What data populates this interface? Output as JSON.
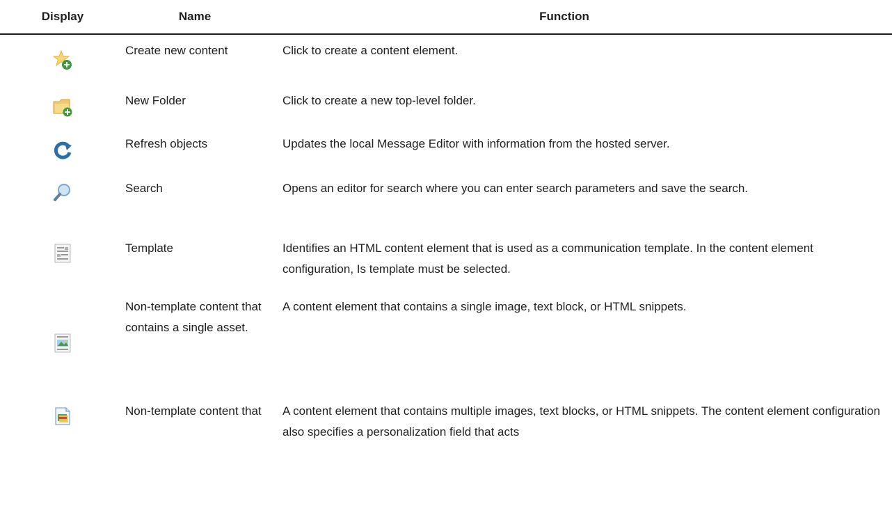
{
  "header": {
    "display": "Display",
    "name": "Name",
    "function": "Function"
  },
  "rows": [
    {
      "icon": "star-add-icon",
      "name": "Create new content",
      "function": "Click to create a content element."
    },
    {
      "icon": "folder-add-icon",
      "name": "New Folder",
      "function": "Click to create a new top-level folder."
    },
    {
      "icon": "refresh-icon",
      "name": "Refresh objects",
      "function": "Updates the local Message Editor with information from the hosted server."
    },
    {
      "icon": "search-icon",
      "name": "Search",
      "function": "Opens an editor for search where you can enter search parameters and save the search."
    },
    {
      "icon": "template-icon",
      "name": "Template",
      "function": "Identifies an HTML content element that is used as a communication template. In the content element configuration, Is template must be selected."
    },
    {
      "icon": "single-asset-icon",
      "name": "Non-template content that contains a single asset.",
      "function": "A content element that contains a single image, text block, or HTML snippets."
    },
    {
      "icon": "multi-asset-icon",
      "name": "Non-template content that",
      "function": "A content element that contains multiple images, text blocks, or HTML snippets. The content element configuration also specifies a personalization field that acts"
    }
  ]
}
